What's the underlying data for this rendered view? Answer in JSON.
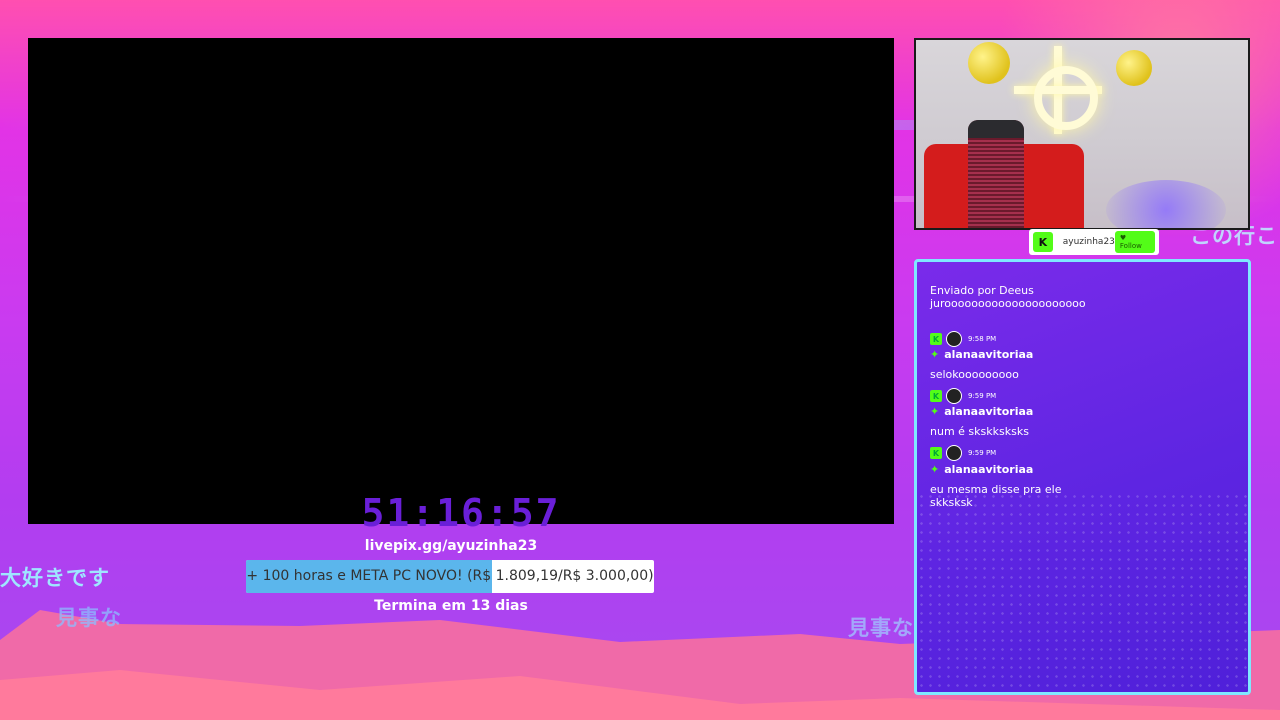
{
  "background": {
    "japanese_text": [
      "大好きです",
      "見事な",
      "見事な",
      "この行こ"
    ]
  },
  "video": {
    "timer": "51:16:57"
  },
  "donation": {
    "link": "livepix.gg/ayuzinha23",
    "goal_label": "+ 100 horas e META PC NOVO! (R$ 1.809,19/R$ 3.000,00)",
    "progress": 0.603,
    "ends": "Termina em 13 dias"
  },
  "follow": {
    "badge": "K",
    "username": "ayuzinha23",
    "button_label": "Follow"
  },
  "chat": {
    "sent_by": "Enviado por Deeus",
    "first_message": "jurooooooooooooooooooooo",
    "messages": [
      {
        "badge": "K",
        "time": "9:58 PM",
        "user": "alanaavitoriaa",
        "text": "selokooooooooo"
      },
      {
        "badge": "K",
        "time": "9:59 PM",
        "user": "alanaavitoriaa",
        "text": "num é skskksksks"
      },
      {
        "badge": "K",
        "time": "9:59 PM",
        "user": "alanaavitoriaa",
        "text": "eu mesma disse pra ele skksksk"
      }
    ]
  },
  "colors": {
    "accent_green": "#53fc18",
    "timer": "#6a1fd8",
    "progress_fill": "#5bb6ec",
    "chat_border": "#7fe8ff"
  }
}
